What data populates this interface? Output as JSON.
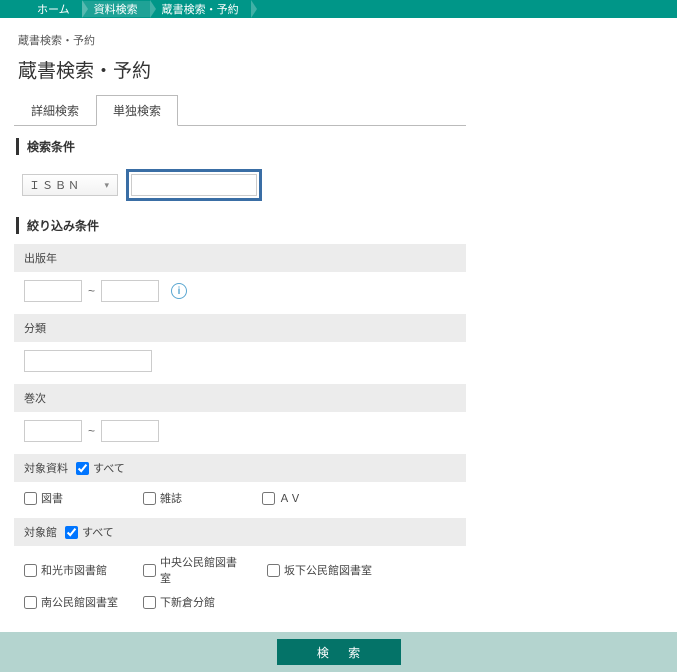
{
  "breadcrumb": {
    "home": "ホーム",
    "search": "資料検索",
    "catalog": "蔵書検索・予約"
  },
  "page": {
    "mini_title": "蔵書検索・予約",
    "title": "蔵書検索・予約"
  },
  "tabs": {
    "detail": "詳細検索",
    "single": "単独検索"
  },
  "sections": {
    "conditions": "検索条件",
    "filters": "絞り込み条件"
  },
  "search": {
    "field_type": "ＩＳＢＮ",
    "value": ""
  },
  "filters": {
    "pub_year": {
      "label": "出版年",
      "from": "",
      "to": ""
    },
    "classification": {
      "label": "分類",
      "value": ""
    },
    "volume": {
      "label": "巻次",
      "from": "",
      "to": ""
    },
    "target_material": {
      "label": "対象資料",
      "all_label": "すべて",
      "all_checked": true,
      "options": [
        {
          "label": "図書",
          "checked": false
        },
        {
          "label": "雑誌",
          "checked": false
        },
        {
          "label": "ＡＶ",
          "checked": false
        }
      ]
    },
    "target_library": {
      "label": "対象館",
      "all_label": "すべて",
      "all_checked": true,
      "options": [
        {
          "label": "和光市図書館",
          "checked": false
        },
        {
          "label": "中央公民館図書室",
          "checked": false
        },
        {
          "label": "坂下公民館図書室",
          "checked": false
        },
        {
          "label": "南公民館図書室",
          "checked": false
        },
        {
          "label": "下新倉分館",
          "checked": false
        }
      ]
    }
  },
  "buttons": {
    "search": "検 索"
  }
}
